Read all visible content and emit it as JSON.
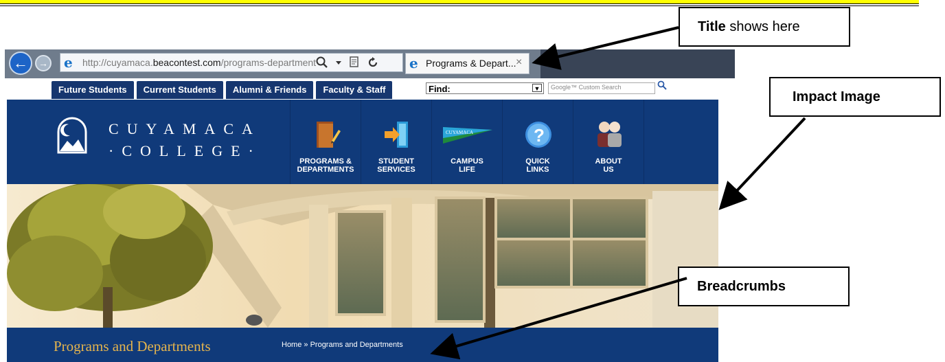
{
  "browser": {
    "url_prefix": "http://cuyamaca.",
    "url_domain": "beacontest.com",
    "url_path": "/programs-departments/defa",
    "tab_title": "Programs & Depart...",
    "tab_close": "×",
    "back_glyph": "←",
    "forward_glyph": "→",
    "ie_glyph": "e"
  },
  "site_tabs": [
    {
      "label": "Future Students"
    },
    {
      "label": "Current Students"
    },
    {
      "label": "Alumni & Friends"
    },
    {
      "label": "Faculty & Staff"
    }
  ],
  "find": {
    "label": "Find:",
    "search_placeholder": "Google™ Custom Search"
  },
  "logo": {
    "line1": "CUYAMACA",
    "line2": "·COLLEGE·"
  },
  "main_nav": [
    {
      "line1": "PROGRAMS &",
      "line2": "DEPARTMENTS",
      "icon": "folder-pencil-icon"
    },
    {
      "line1": "STUDENT",
      "line2": "SERVICES",
      "icon": "door-arrow-icon"
    },
    {
      "line1": "CAMPUS",
      "line2": "LIFE",
      "icon": "pennant-icon",
      "pennant_text": "CUYAMACA"
    },
    {
      "line1": "QUICK",
      "line2": "LINKS",
      "icon": "question-icon"
    },
    {
      "line1": "ABOUT",
      "line2": "US",
      "icon": "people-icon"
    }
  ],
  "breadcrumb": {
    "page_title": "Programs and Departments",
    "path": "Home » Programs and Departments"
  },
  "callouts": {
    "title_bold": "Title",
    "title_rest": " shows here",
    "impact": "Impact Image",
    "breadcrumbs": "Breadcrumbs"
  },
  "colors": {
    "header_blue": "#103a7a",
    "gold": "#e5b44d",
    "doc_rule": "#ffff00"
  }
}
